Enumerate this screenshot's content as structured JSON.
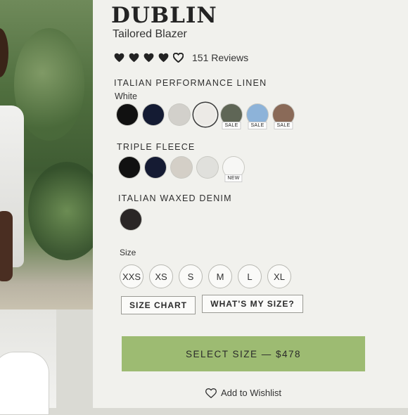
{
  "product": {
    "brand": "DUBLIN",
    "subtitle": "Tailored Blazer",
    "rating_hearts": 5,
    "reviews": "151 Reviews"
  },
  "fabrics": [
    {
      "label": "ITALIAN PERFORMANCE LINEN",
      "selected_color": "White",
      "swatches": [
        {
          "name": "black",
          "color": "#111111"
        },
        {
          "name": "navy",
          "color": "#141b33"
        },
        {
          "name": "light-grey",
          "color": "#d2d0cb"
        },
        {
          "name": "white",
          "color": "#eceae6",
          "selected": true
        },
        {
          "name": "olive",
          "color": "#5f6656",
          "tag": "SALE"
        },
        {
          "name": "sky-blue",
          "color": "#8db3d9",
          "tag": "SALE"
        },
        {
          "name": "brown",
          "color": "#8a6a58",
          "tag": "SALE"
        }
      ]
    },
    {
      "label": "TRIPLE FLEECE",
      "swatches": [
        {
          "name": "black",
          "color": "#111111"
        },
        {
          "name": "navy",
          "color": "#151b33"
        },
        {
          "name": "oatmeal",
          "color": "#d4cfc7"
        },
        {
          "name": "pale-grey",
          "color": "#e0e0dc"
        },
        {
          "name": "white",
          "color": "#f7f7f5",
          "tag": "NEW"
        }
      ]
    },
    {
      "label": "ITALIAN WAXED DENIM",
      "swatches": [
        {
          "name": "black-denim",
          "color": "#2a2626"
        }
      ]
    }
  ],
  "size": {
    "label": "Size",
    "options": [
      "XXS",
      "XS",
      "S",
      "M",
      "L",
      "XL"
    ]
  },
  "buttons": {
    "size_chart": "SIZE CHART",
    "whats_my_size": "WHAT'S MY SIZE?",
    "cta": "SELECT SIZE — $478",
    "wishlist": "Add to Wishlist"
  },
  "colors": {
    "cta_bg": "#9dbb72",
    "panel_bg": "#f1f1ed"
  }
}
